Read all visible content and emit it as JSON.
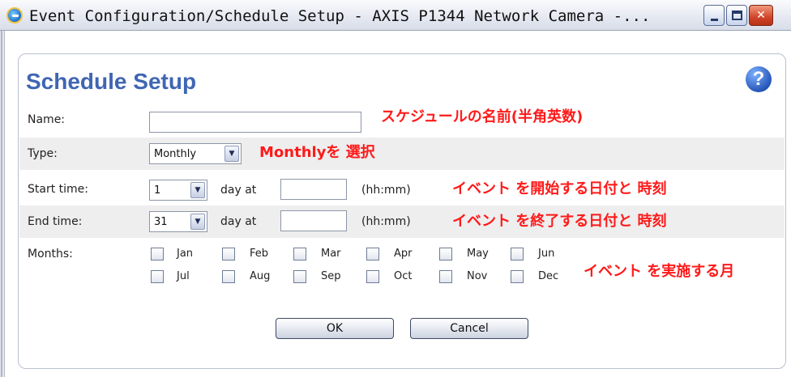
{
  "window": {
    "title": "Event Configuration/Schedule Setup - AXIS P1344 Network Camera -...",
    "min_icon": "minimize-icon",
    "max_icon": "maximize-icon",
    "close_glyph": "✕"
  },
  "heading": "Schedule Setup",
  "help": {
    "glyph": "?",
    "icon": "help-icon"
  },
  "form": {
    "name_label": "Name:",
    "name_value": "",
    "type_label": "Type:",
    "type_value": "Monthly",
    "start_label": "Start time:",
    "start_day": "1",
    "start_day_at": "day at",
    "start_time_value": "",
    "start_format": "(hh:mm)",
    "end_label": "End time:",
    "end_day": "31",
    "end_day_at": "day at",
    "end_time_value": "",
    "end_format": "(hh:mm)",
    "months_label": "Months:",
    "months": [
      "Jan",
      "Feb",
      "Mar",
      "Apr",
      "May",
      "Jun",
      "Jul",
      "Aug",
      "Sep",
      "Oct",
      "Nov",
      "Dec"
    ]
  },
  "annotations": {
    "name": "スケジュールの名前(半角英数)",
    "type": "Monthlyを 選択",
    "start": "イベント を開始する日付と 時刻",
    "end": "イベント を終了する日付と 時刻",
    "months": "イベント を実施する月"
  },
  "buttons": {
    "ok": "OK",
    "cancel": "Cancel"
  },
  "colors": {
    "heading": "#3f66b3",
    "annotation": "#ff1a1a",
    "row_shade": "#eeeeee"
  }
}
